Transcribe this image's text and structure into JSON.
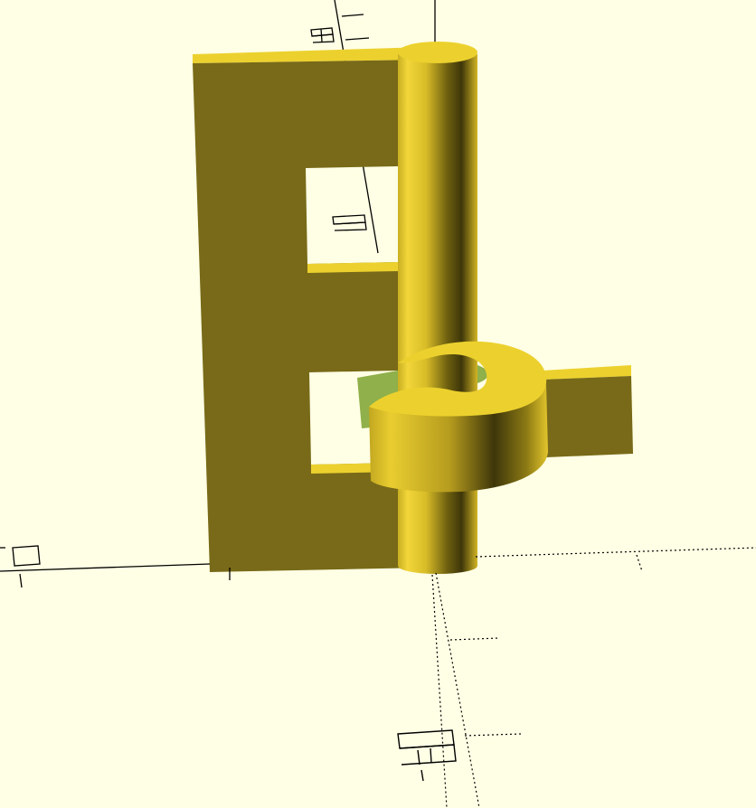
{
  "viewport": {
    "background_color": "#ffffe5",
    "axis_color": "#000000",
    "colors": {
      "top_face": "#ecd12e",
      "front_face": "#786a18",
      "cylinder_light": "#f2d63a",
      "cylinder_mid": "#b9a020",
      "cylinder_dark": "#3e360a",
      "inner_bore": "#8fb04a"
    }
  }
}
